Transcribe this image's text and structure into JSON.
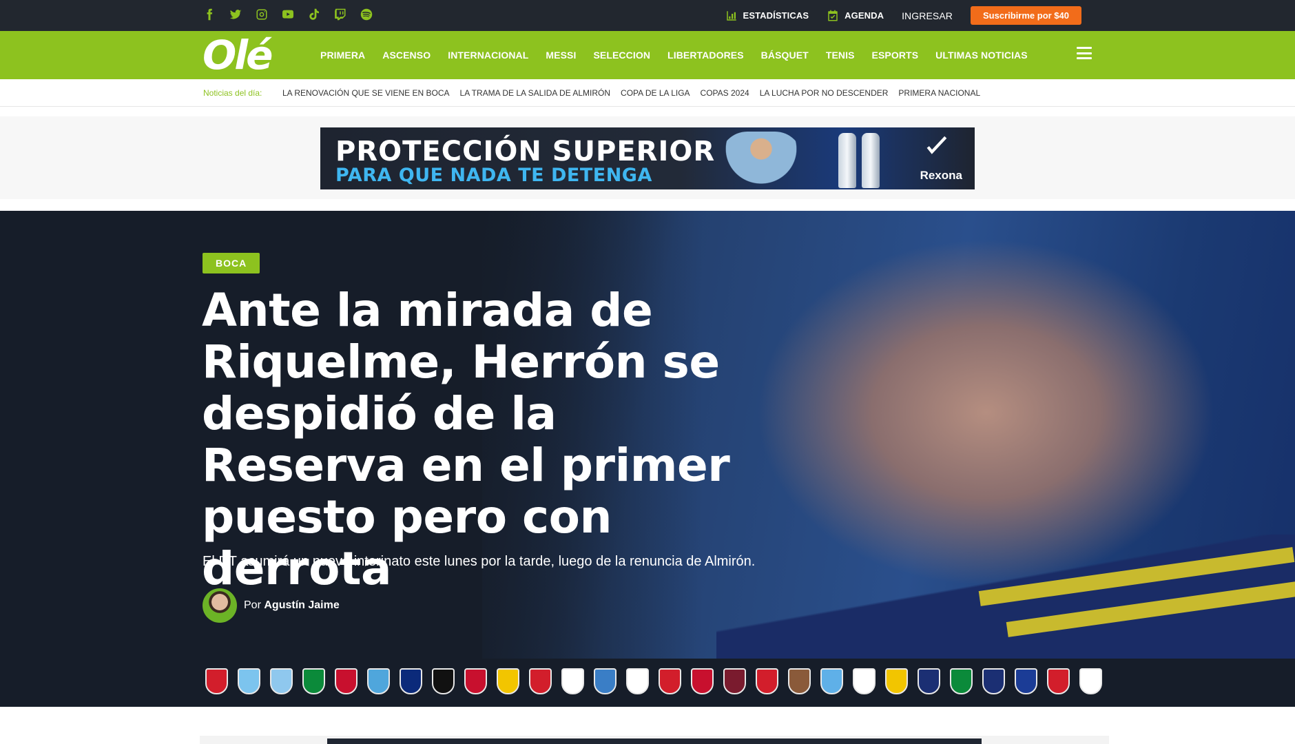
{
  "social_icons": [
    "facebook-icon",
    "twitter-icon",
    "instagram-icon",
    "youtube-icon",
    "tiktok-icon",
    "twitch-icon",
    "spotify-icon"
  ],
  "top_links": {
    "estadisticas": "ESTADÍSTICAS",
    "agenda": "AGENDA",
    "ingresar": "INGRESAR",
    "subscribe": "Suscribirme por $40"
  },
  "brand": {
    "logo": "Olé",
    "accent": "#8dc21f",
    "dark": "#22272f",
    "cta": "#f26c1a"
  },
  "nav": [
    "PRIMERA",
    "ASCENSO",
    "INTERNACIONAL",
    "MESSI",
    "SELECCION",
    "LIBERTADORES",
    "BÁSQUET",
    "TENIS",
    "ESPORTS",
    "ULTIMAS NOTICIAS"
  ],
  "trending": {
    "label": "Noticias del día:",
    "items": [
      "LA RENOVACIÓN QUE SE VIENE EN BOCA",
      "LA TRAMA DE LA SALIDA DE ALMIRÓN",
      "COPA DE LA LIGA",
      "COPAS 2024",
      "LA LUCHA POR NO DESCENDER",
      "PRIMERA NACIONAL"
    ]
  },
  "ad": {
    "line1": "PROTECCIÓN SUPERIOR",
    "line2": "PARA QUE NADA TE DETENGA",
    "brand": "Rexona"
  },
  "article": {
    "tag": "BOCA",
    "headline": "Ante la mirada de Riquelme, Herrón se despidió de la Reserva en el primer puesto pero con derrota",
    "subhead": "El DT asumirá un nuevo interinato este lunes por la tarde, luego de la renuncia de Almirón.",
    "author_prefix": "Por",
    "author_name": "Agustín Jaime"
  },
  "club_crests": [
    {
      "club": "argentinos",
      "color": "#d21e2b"
    },
    {
      "club": "arsenal",
      "color": "#7cc4ee"
    },
    {
      "club": "atletico-tucuman",
      "color": "#8fc8ee"
    },
    {
      "club": "banfield",
      "color": "#0b8a3a"
    },
    {
      "club": "barracas",
      "color": "#c8102e"
    },
    {
      "club": "belgrano",
      "color": "#4fa6dc"
    },
    {
      "club": "boca",
      "color": "#0b2a7a"
    },
    {
      "club": "central-cordoba",
      "color": "#111111"
    },
    {
      "club": "colon",
      "color": "#c8102e"
    },
    {
      "club": "defensa",
      "color": "#f2c500"
    },
    {
      "club": "estudiantes",
      "color": "#d21e2b"
    },
    {
      "club": "gimnasia",
      "color": "#ffffff"
    },
    {
      "club": "godoy-cruz",
      "color": "#3a7ec6"
    },
    {
      "club": "huracan",
      "color": "#ffffff"
    },
    {
      "club": "independiente",
      "color": "#d21e2b"
    },
    {
      "club": "instituto",
      "color": "#c8102e"
    },
    {
      "club": "lanus",
      "color": "#7a1b2e"
    },
    {
      "club": "newells",
      "color": "#d21e2b"
    },
    {
      "club": "platense",
      "color": "#8a5a3a"
    },
    {
      "club": "racing",
      "color": "#5fb0e8"
    },
    {
      "club": "river",
      "color": "#ffffff"
    },
    {
      "club": "rosario-central",
      "color": "#f2c500"
    },
    {
      "club": "san-lorenzo",
      "color": "#1b2f73"
    },
    {
      "club": "sarmiento",
      "color": "#0b8a3a"
    },
    {
      "club": "talleres",
      "color": "#1b2f73"
    },
    {
      "club": "tigre",
      "color": "#1b3c96"
    },
    {
      "club": "union",
      "color": "#d21e2b"
    },
    {
      "club": "velez",
      "color": "#ffffff"
    }
  ]
}
